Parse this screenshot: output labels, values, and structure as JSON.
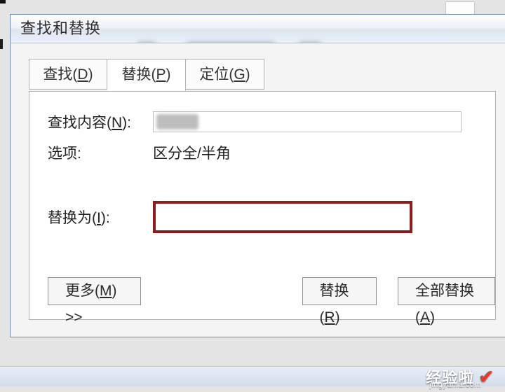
{
  "dialog": {
    "title": "查找和替换",
    "tabs": [
      {
        "label_pre": "查找(",
        "hotkey": "D",
        "label_post": ")",
        "active": false
      },
      {
        "label_pre": "替换(",
        "hotkey": "P",
        "label_post": ")",
        "active": true
      },
      {
        "label_pre": "定位(",
        "hotkey": "G",
        "label_post": ")",
        "active": false
      }
    ],
    "find": {
      "label_pre": "查找内容(",
      "hotkey": "N",
      "label_post": "):",
      "value": ""
    },
    "options": {
      "label": "选项:",
      "value": "区分全/半角"
    },
    "replace": {
      "label_pre": "替换为(",
      "hotkey": "I",
      "label_post": "):",
      "value": ""
    },
    "buttons": {
      "more": {
        "pre": "更多(",
        "hotkey": "M",
        "post": ") >>"
      },
      "replace": {
        "pre": "替换(",
        "hotkey": "R",
        "post": ")"
      },
      "replace_all": {
        "pre": "全部替换(",
        "hotkey": "A",
        "post": ")"
      }
    }
  },
  "watermark": {
    "brand": "经验啦",
    "site": "jingyanla.com"
  }
}
